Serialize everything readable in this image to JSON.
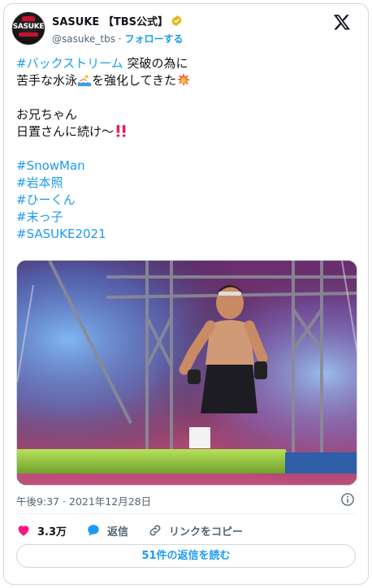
{
  "account": {
    "display_name": "SASUKE 【TBS公式】",
    "handle": "@sasuke_tbs",
    "separator": "·",
    "follow_label": "フォローする",
    "avatar_logo_text": "SASUKE"
  },
  "tweet": {
    "line1_tag": "#バックストリーム",
    "line1_text": " 突破の為に",
    "line2_text": "苦手な水泳",
    "line2_text_b": "を強化してきた",
    "line4_text": "お兄ちゃん",
    "line5_text": "日置さんに続け〜",
    "hashtags": [
      "#SnowMan",
      "#岩本照",
      "#ひーくん",
      "#末っ子",
      "#SASUKE2021"
    ]
  },
  "icons": {
    "verified": "verified-badge-icon",
    "brand": "x-logo-icon",
    "swimmer": "swimmer-emoji-icon",
    "collision": "collision-emoji-icon",
    "exclamation": "double-exclamation-emoji-icon",
    "info": "info-icon",
    "like": "heart-icon",
    "reply": "reply-bubble-icon",
    "link": "link-icon"
  },
  "meta": {
    "timestamp": "午後9:37 · 2021年12月28日"
  },
  "actions": {
    "like_count": "3.3万",
    "reply_label": "返信",
    "copy_link_label": "リンクをコピー"
  },
  "replies_button": "51件の返信を読む",
  "colors": {
    "accent": "#1d9bf0",
    "like": "#f91880",
    "text": "#0f1419",
    "muted": "#536471",
    "border": "#cfd9de"
  }
}
